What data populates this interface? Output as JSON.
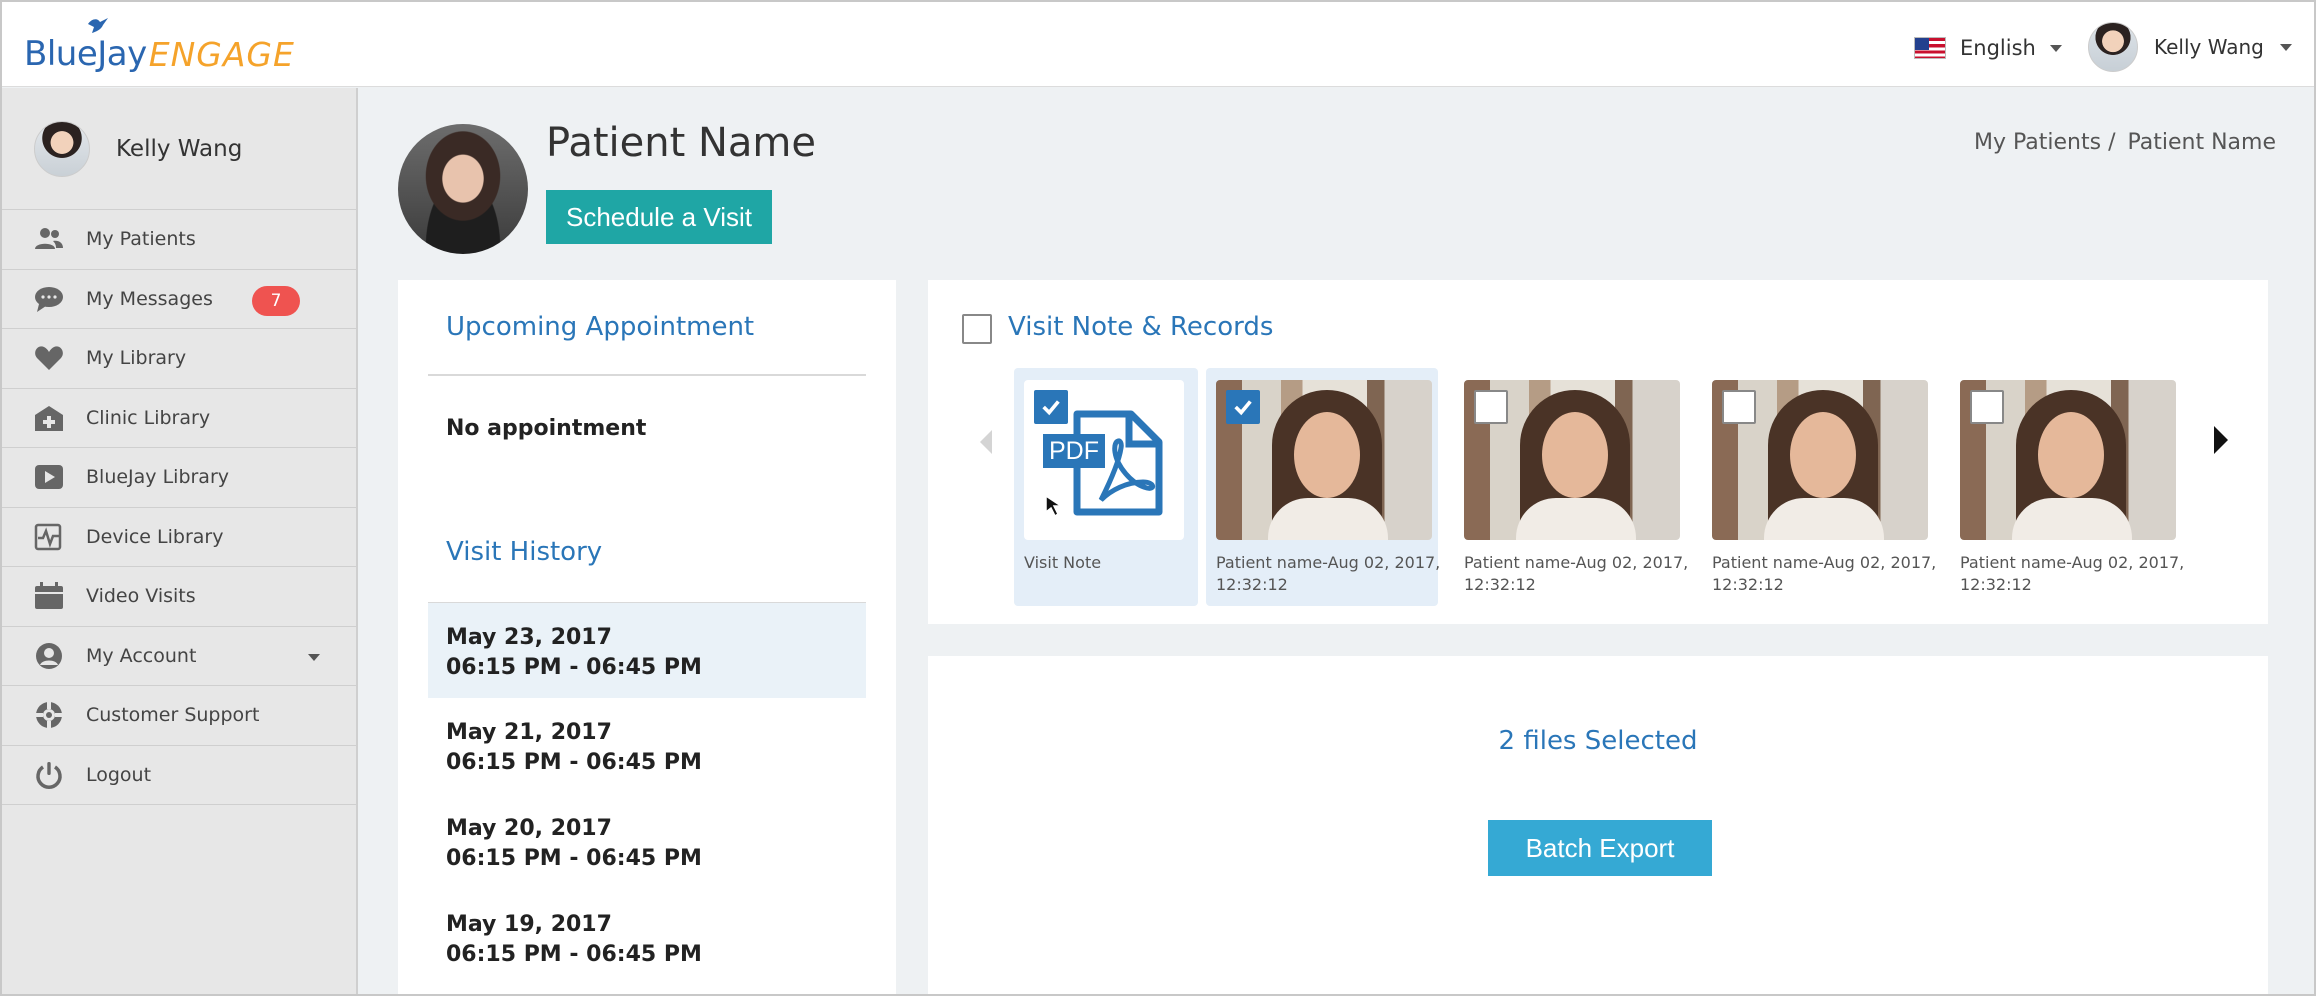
{
  "app": {
    "logo_main": "BlueJay",
    "logo_accent": "ENGAGE"
  },
  "topbar": {
    "language": "English",
    "user_name": "Kelly Wang"
  },
  "sidebar": {
    "user_name": "Kelly Wang",
    "items": [
      {
        "label": "My Patients",
        "icon": "patients-icon"
      },
      {
        "label": "My Messages",
        "icon": "messages-icon",
        "badge": "7"
      },
      {
        "label": "My Library",
        "icon": "heart-icon"
      },
      {
        "label": "Clinic Library",
        "icon": "clinic-icon"
      },
      {
        "label": "BlueJay Library",
        "icon": "play-icon"
      },
      {
        "label": "Device Library",
        "icon": "device-icon"
      },
      {
        "label": "Video Visits",
        "icon": "calendar-icon"
      },
      {
        "label": "My Account",
        "icon": "account-icon"
      },
      {
        "label": "Customer Support",
        "icon": "support-icon"
      },
      {
        "label": "Logout",
        "icon": "power-icon"
      }
    ]
  },
  "patient": {
    "name": "Patient Name",
    "schedule_label": "Schedule a Visit"
  },
  "breadcrumb": {
    "parent": "My Patients /",
    "current": "Patient Name"
  },
  "upcoming": {
    "title": "Upcoming Appointment",
    "empty_text": "No appointment"
  },
  "history": {
    "title": "Visit History",
    "items": [
      {
        "date": "May 23, 2017",
        "time": "06:15 PM - 06:45 PM",
        "selected": true
      },
      {
        "date": "May 21, 2017",
        "time": "06:15 PM - 06:45 PM",
        "selected": false
      },
      {
        "date": "May 20, 2017",
        "time": "06:15 PM - 06:45 PM",
        "selected": false
      },
      {
        "date": "May 19, 2017",
        "time": "06:15 PM - 06:45 PM",
        "selected": false
      }
    ]
  },
  "records": {
    "title": "Visit Note & Records",
    "tiles": [
      {
        "label": "Visit Note",
        "kind": "pdf",
        "pdf_text": "PDF",
        "checked": true
      },
      {
        "label": "Patient name-Aug 02, 2017, 12:32:12",
        "kind": "photo",
        "checked": true
      },
      {
        "label": "Patient name-Aug 02, 2017, 12:32:12",
        "kind": "photo",
        "checked": false
      },
      {
        "label": "Patient name-Aug 02, 2017, 12:32:12",
        "kind": "photo",
        "checked": false
      },
      {
        "label": "Patient name-Aug 02, 2017, 12:32:12",
        "kind": "photo",
        "checked": false
      }
    ]
  },
  "export": {
    "status": "2 files Selected",
    "button_label": "Batch Export"
  },
  "colors": {
    "primary_blue": "#2a76b8",
    "teal": "#1fa6a5",
    "export_blue": "#35a9d4",
    "badge_red": "#ef5350",
    "logo_orange": "#f5a32b"
  }
}
